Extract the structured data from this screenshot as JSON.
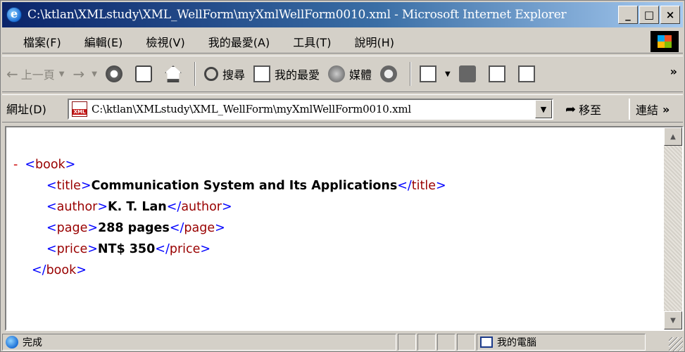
{
  "window": {
    "title": "C:\\ktlan\\XMLstudy\\XML_WellForm\\myXmlWellForm0010.xml - Microsoft Internet Explorer",
    "buttons": {
      "minimize": "_",
      "maximize": "□",
      "close": "×"
    }
  },
  "menu": [
    {
      "label": "檔案(F)"
    },
    {
      "label": "編輯(E)"
    },
    {
      "label": "檢視(V)"
    },
    {
      "label": "我的最愛(A)"
    },
    {
      "label": "工具(T)"
    },
    {
      "label": "說明(H)"
    }
  ],
  "toolbar": {
    "back_label": "上一頁",
    "search_label": "搜尋",
    "favorites_label": "我的最愛",
    "media_label": "媒體"
  },
  "address": {
    "label": "網址(D)",
    "value": "C:\\ktlan\\XMLstudy\\XML_WellForm\\myXmlWellForm0010.xml",
    "go_label": "移至",
    "links_label": "連結"
  },
  "xml": {
    "collapse_symbol": "-",
    "root_open": "book",
    "root_close": "book",
    "elements": [
      {
        "tag": "title",
        "value": "Communication System and Its Applications"
      },
      {
        "tag": "author",
        "value": "K. T. Lan"
      },
      {
        "tag": "page",
        "value": "288 pages"
      },
      {
        "tag": "price",
        "value": "NT$ 350"
      }
    ]
  },
  "status": {
    "text": "完成",
    "zone": "我的電腦"
  },
  "colors": {
    "titlebar_start": "#0a246a",
    "titlebar_end": "#a6caf0",
    "xml_bracket": "#0000ff",
    "xml_tag_name": "#990000",
    "collapse_minus": "#cc0000",
    "chrome": "#d4d0c8"
  }
}
